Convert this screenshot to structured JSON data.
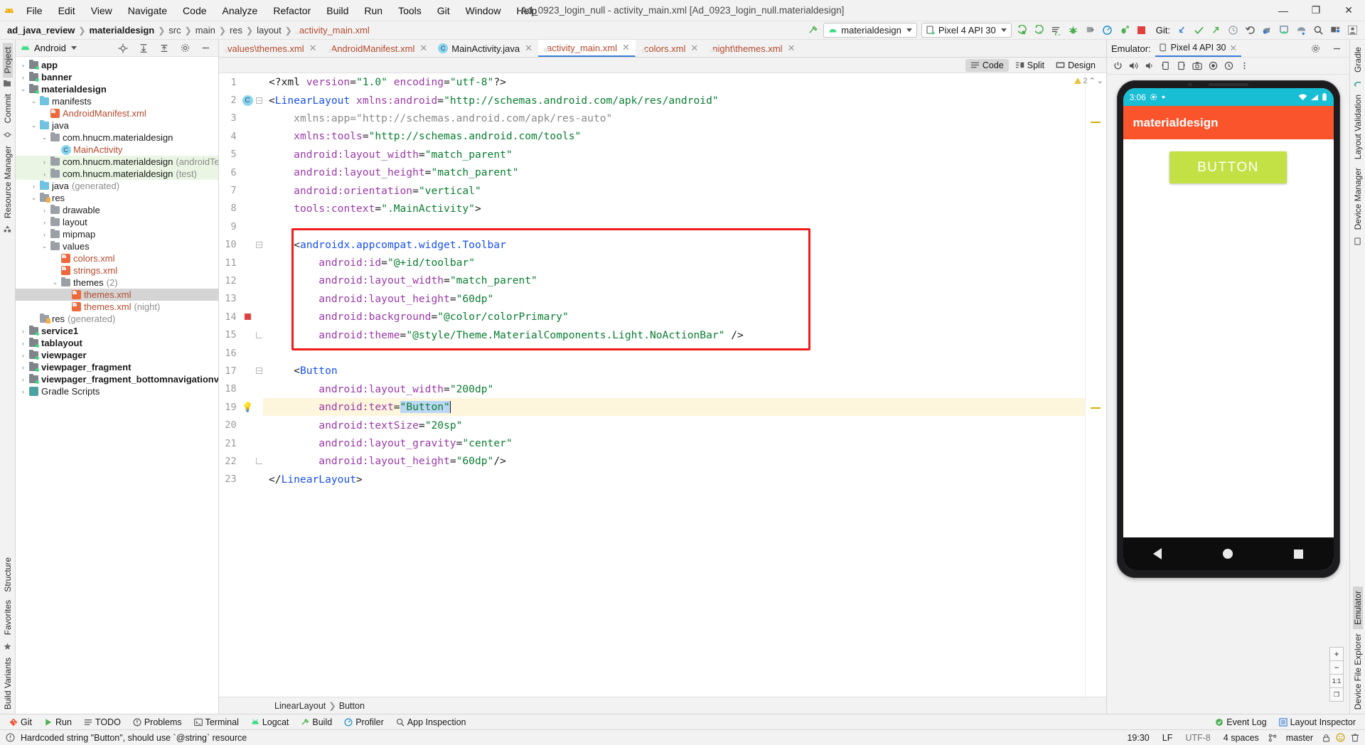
{
  "window": {
    "title": "Ad_0923_login_null - activity_main.xml [Ad_0923_login_null.materialdesign]",
    "minimize": "—",
    "maximize": "❐",
    "close": "✕"
  },
  "menu": [
    "File",
    "Edit",
    "View",
    "Navigate",
    "Code",
    "Analyze",
    "Refactor",
    "Build",
    "Run",
    "Tools",
    "Git",
    "Window",
    "Help"
  ],
  "breadcrumbs": [
    {
      "label": "ad_java_review",
      "bold": true
    },
    {
      "label": "materialdesign",
      "bold": true
    },
    {
      "label": "src",
      "bold": false
    },
    {
      "label": "main",
      "bold": false
    },
    {
      "label": "res",
      "bold": false
    },
    {
      "label": "layout",
      "bold": false
    },
    {
      "label": "activity_main.xml",
      "bold": false,
      "xml": true
    }
  ],
  "toolbar": {
    "run_config": "materialdesign",
    "device": "Pixel 4 API 30",
    "git_label": "Git:"
  },
  "project": {
    "selector": "Android",
    "tree": [
      {
        "indent": 0,
        "arrow": "›",
        "icon": "module",
        "label": "app",
        "bold": true
      },
      {
        "indent": 0,
        "arrow": "›",
        "icon": "module",
        "label": "banner",
        "bold": true
      },
      {
        "indent": 0,
        "arrow": "⌄",
        "icon": "module",
        "label": "materialdesign",
        "bold": true
      },
      {
        "indent": 1,
        "arrow": "⌄",
        "icon": "folder-blue",
        "label": "manifests"
      },
      {
        "indent": 2,
        "arrow": "",
        "icon": "manifest",
        "label": "AndroidManifest.xml",
        "xml": true
      },
      {
        "indent": 1,
        "arrow": "⌄",
        "icon": "folder-blue",
        "label": "java"
      },
      {
        "indent": 2,
        "arrow": "⌄",
        "icon": "folder",
        "label": "com.hnucm.materialdesign"
      },
      {
        "indent": 3,
        "arrow": "",
        "icon": "class",
        "label": "MainActivity",
        "xml": true
      },
      {
        "indent": 2,
        "arrow": "›",
        "icon": "folder",
        "label": "com.hnucm.materialdesign",
        "sub": "(androidTest)",
        "green": true
      },
      {
        "indent": 2,
        "arrow": "›",
        "icon": "folder",
        "label": "com.hnucm.materialdesign",
        "sub": "(test)",
        "green": true
      },
      {
        "indent": 1,
        "arrow": "›",
        "icon": "folder-gen",
        "label": "java",
        "sub": "(generated)"
      },
      {
        "indent": 1,
        "arrow": "⌄",
        "icon": "res",
        "label": "res"
      },
      {
        "indent": 2,
        "arrow": "›",
        "icon": "folder",
        "label": "drawable"
      },
      {
        "indent": 2,
        "arrow": "›",
        "icon": "folder",
        "label": "layout"
      },
      {
        "indent": 2,
        "arrow": "›",
        "icon": "folder",
        "label": "mipmap"
      },
      {
        "indent": 2,
        "arrow": "⌄",
        "icon": "folder",
        "label": "values"
      },
      {
        "indent": 3,
        "arrow": "",
        "icon": "xml",
        "label": "colors.xml",
        "xml": true
      },
      {
        "indent": 3,
        "arrow": "",
        "icon": "xml",
        "label": "strings.xml",
        "xml": true
      },
      {
        "indent": 3,
        "arrow": "⌄",
        "icon": "folder",
        "label": "themes",
        "sub": "(2)"
      },
      {
        "indent": 4,
        "arrow": "",
        "icon": "xml",
        "label": "themes.xml",
        "xml": true,
        "selected": true
      },
      {
        "indent": 4,
        "arrow": "",
        "icon": "xml",
        "label": "themes.xml",
        "sub": "(night)",
        "xml": true
      },
      {
        "indent": 1,
        "arrow": "",
        "icon": "res",
        "label": "res",
        "sub": "(generated)"
      },
      {
        "indent": 0,
        "arrow": "›",
        "icon": "module",
        "label": "service1",
        "bold": true
      },
      {
        "indent": 0,
        "arrow": "›",
        "icon": "module",
        "label": "tablayout",
        "bold": true
      },
      {
        "indent": 0,
        "arrow": "›",
        "icon": "module",
        "label": "viewpager",
        "bold": true
      },
      {
        "indent": 0,
        "arrow": "›",
        "icon": "module",
        "label": "viewpager_fragment",
        "bold": true
      },
      {
        "indent": 0,
        "arrow": "›",
        "icon": "module",
        "label": "viewpager_fragment_bottomnavigationview",
        "bold": true
      },
      {
        "indent": 0,
        "arrow": "›",
        "icon": "gradle",
        "label": "Gradle Scripts",
        "bold": false
      }
    ]
  },
  "left_rail": [
    "Project",
    "Commit",
    "Resource Manager"
  ],
  "right_rail": [
    "Gradle",
    "Layout Validation",
    "Device Manager",
    "Emulator",
    "Device File Explorer"
  ],
  "far_left_bottom_rail": [
    "Structure",
    "Favorites",
    "Build Variants"
  ],
  "editor_tabs": [
    {
      "label": "values\\themes.xml",
      "icon": "xml",
      "active": false
    },
    {
      "label": "AndroidManifest.xml",
      "icon": "manifest",
      "active": false
    },
    {
      "label": "MainActivity.java",
      "icon": "class",
      "active": false
    },
    {
      "label": "activity_main.xml",
      "icon": "xml",
      "active": true
    },
    {
      "label": "colors.xml",
      "icon": "xml",
      "active": false
    },
    {
      "label": "night\\themes.xml",
      "icon": "xml",
      "active": false
    }
  ],
  "view_modes": [
    {
      "label": "Code",
      "active": true
    },
    {
      "label": "Split",
      "active": false
    },
    {
      "label": "Design",
      "active": false
    }
  ],
  "inspection": {
    "warning_count": "2"
  },
  "code": {
    "lines": [
      {
        "n": 1,
        "segments": [
          {
            "t": "<?xml ",
            "c": "punct"
          },
          {
            "t": "version",
            "c": "attr"
          },
          {
            "t": "=",
            "c": "punct"
          },
          {
            "t": "\"1.0\"",
            "c": "val"
          },
          {
            "t": " ",
            "c": "punct"
          },
          {
            "t": "encoding",
            "c": "attr"
          },
          {
            "t": "=",
            "c": "punct"
          },
          {
            "t": "\"utf-8\"",
            "c": "val"
          },
          {
            "t": "?>",
            "c": "punct"
          }
        ]
      },
      {
        "n": 2,
        "marker": "class",
        "fold": "open",
        "segments": [
          {
            "t": "<",
            "c": "punct"
          },
          {
            "t": "LinearLayout",
            "c": "tag"
          },
          {
            "t": " ",
            "c": "punct"
          },
          {
            "t": "xmlns:android",
            "c": "ns"
          },
          {
            "t": "=",
            "c": "punct"
          },
          {
            "t": "\"http://schemas.android.com/apk/res/android\"",
            "c": "val"
          }
        ]
      },
      {
        "n": 3,
        "segments": [
          {
            "t": "    ",
            "c": "punct"
          },
          {
            "t": "xmlns:app",
            "c": "gray"
          },
          {
            "t": "=",
            "c": "gray"
          },
          {
            "t": "\"http://schemas.android.com/apk/res-auto\"",
            "c": "gray"
          }
        ]
      },
      {
        "n": 4,
        "segments": [
          {
            "t": "    ",
            "c": "punct"
          },
          {
            "t": "xmlns:tools",
            "c": "ns"
          },
          {
            "t": "=",
            "c": "punct"
          },
          {
            "t": "\"http://schemas.android.com/tools\"",
            "c": "val"
          }
        ]
      },
      {
        "n": 5,
        "segments": [
          {
            "t": "    ",
            "c": "punct"
          },
          {
            "t": "android:layout_width",
            "c": "attr"
          },
          {
            "t": "=",
            "c": "punct"
          },
          {
            "t": "\"match_parent\"",
            "c": "val"
          }
        ]
      },
      {
        "n": 6,
        "segments": [
          {
            "t": "    ",
            "c": "punct"
          },
          {
            "t": "android:layout_height",
            "c": "attr"
          },
          {
            "t": "=",
            "c": "punct"
          },
          {
            "t": "\"match_parent\"",
            "c": "val"
          }
        ]
      },
      {
        "n": 7,
        "segments": [
          {
            "t": "    ",
            "c": "punct"
          },
          {
            "t": "android:orientation",
            "c": "attr"
          },
          {
            "t": "=",
            "c": "punct"
          },
          {
            "t": "\"vertical\"",
            "c": "val"
          }
        ]
      },
      {
        "n": 8,
        "segments": [
          {
            "t": "    ",
            "c": "punct"
          },
          {
            "t": "tools:context",
            "c": "attr"
          },
          {
            "t": "=",
            "c": "punct"
          },
          {
            "t": "\".MainActivity\"",
            "c": "val"
          },
          {
            "t": ">",
            "c": "punct"
          }
        ]
      },
      {
        "n": 9,
        "segments": []
      },
      {
        "n": 10,
        "fold": "closed",
        "segments": [
          {
            "t": "    <",
            "c": "punct"
          },
          {
            "t": "androidx.appcompat.widget.Toolbar",
            "c": "tag"
          }
        ]
      },
      {
        "n": 11,
        "segments": [
          {
            "t": "        ",
            "c": "punct"
          },
          {
            "t": "android:id",
            "c": "attr"
          },
          {
            "t": "=",
            "c": "punct"
          },
          {
            "t": "\"@+id/toolbar\"",
            "c": "val"
          }
        ]
      },
      {
        "n": 12,
        "segments": [
          {
            "t": "        ",
            "c": "punct"
          },
          {
            "t": "android:layout_width",
            "c": "attr"
          },
          {
            "t": "=",
            "c": "punct"
          },
          {
            "t": "\"match_parent\"",
            "c": "val"
          }
        ]
      },
      {
        "n": 13,
        "segments": [
          {
            "t": "        ",
            "c": "punct"
          },
          {
            "t": "android:layout_height",
            "c": "attr"
          },
          {
            "t": "=",
            "c": "punct"
          },
          {
            "t": "\"60dp\"",
            "c": "val"
          }
        ]
      },
      {
        "n": 14,
        "marker": "error",
        "segments": [
          {
            "t": "        ",
            "c": "punct"
          },
          {
            "t": "android:background",
            "c": "attr"
          },
          {
            "t": "=",
            "c": "punct"
          },
          {
            "t": "\"@color/colorPrimary\"",
            "c": "val"
          }
        ]
      },
      {
        "n": 15,
        "fold": "end",
        "segments": [
          {
            "t": "        ",
            "c": "punct"
          },
          {
            "t": "android:theme",
            "c": "attr"
          },
          {
            "t": "=",
            "c": "punct"
          },
          {
            "t": "\"@style/Theme.MaterialComponents.Light.NoActionBar\"",
            "c": "val"
          },
          {
            "t": " />",
            "c": "punct"
          }
        ]
      },
      {
        "n": 16,
        "segments": []
      },
      {
        "n": 17,
        "fold": "closed",
        "segments": [
          {
            "t": "    <",
            "c": "punct"
          },
          {
            "t": "Button",
            "c": "tag"
          }
        ]
      },
      {
        "n": 18,
        "segments": [
          {
            "t": "        ",
            "c": "punct"
          },
          {
            "t": "android:layout_width",
            "c": "attr"
          },
          {
            "t": "=",
            "c": "punct"
          },
          {
            "t": "\"200dp\"",
            "c": "val"
          }
        ]
      },
      {
        "n": 19,
        "marker": "bulb",
        "highlight": true,
        "segments": [
          {
            "t": "        ",
            "c": "punct"
          },
          {
            "t": "android:text",
            "c": "attr"
          },
          {
            "t": "=",
            "c": "punct"
          },
          {
            "t": "\"Button",
            "c": "val-sel"
          },
          {
            "t": "\"",
            "c": "val-sel"
          }
        ],
        "cursor": true
      },
      {
        "n": 20,
        "segments": [
          {
            "t": "        ",
            "c": "punct"
          },
          {
            "t": "android:textSize",
            "c": "attr"
          },
          {
            "t": "=",
            "c": "punct"
          },
          {
            "t": "\"20sp\"",
            "c": "val"
          }
        ]
      },
      {
        "n": 21,
        "segments": [
          {
            "t": "        ",
            "c": "punct"
          },
          {
            "t": "android:layout_gravity",
            "c": "attr"
          },
          {
            "t": "=",
            "c": "punct"
          },
          {
            "t": "\"center\"",
            "c": "val"
          }
        ]
      },
      {
        "n": 22,
        "fold": "end",
        "segments": [
          {
            "t": "        ",
            "c": "punct"
          },
          {
            "t": "android:layout_height",
            "c": "attr"
          },
          {
            "t": "=",
            "c": "punct"
          },
          {
            "t": "\"60dp\"",
            "c": "val"
          },
          {
            "t": "/>",
            "c": "punct"
          }
        ]
      },
      {
        "n": 23,
        "fold": "endmain",
        "segments": [
          {
            "t": "</",
            "c": "punct"
          },
          {
            "t": "LinearLayout",
            "c": "tag"
          },
          {
            "t": ">",
            "c": "punct"
          }
        ]
      }
    ]
  },
  "editor_breadcrumb": [
    "LinearLayout",
    "Button"
  ],
  "emulator": {
    "panel_label": "Emulator:",
    "tab_label": "Pixel 4 API 30",
    "zoom_in": "+",
    "zoom_out": "−",
    "zoom_fit": "1:1",
    "zoom_actual": "❐",
    "device": {
      "status_time": "3:06",
      "app_title": "materialdesign",
      "button_label": "BUTTON",
      "status_bar_color": "#18bed4",
      "toolbar_color": "#f9542b",
      "button_color": "#c3e044"
    }
  },
  "bottom_tools": [
    {
      "label": "Git",
      "icon": "git"
    },
    {
      "label": "Run",
      "icon": "run"
    },
    {
      "label": "TODO",
      "icon": "todo"
    },
    {
      "label": "Problems",
      "icon": "problems"
    },
    {
      "label": "Terminal",
      "icon": "terminal"
    },
    {
      "label": "Logcat",
      "icon": "logcat"
    },
    {
      "label": "Build",
      "icon": "build"
    },
    {
      "label": "Profiler",
      "icon": "profiler"
    },
    {
      "label": "App Inspection",
      "icon": "inspection"
    }
  ],
  "bottom_right_tools": [
    {
      "label": "Event Log",
      "icon": "event-log"
    },
    {
      "label": "Layout Inspector",
      "icon": "layout-inspector"
    }
  ],
  "status_bar": {
    "message": "Hardcoded string \"Button\", should use `@string` resource",
    "caret": "19:30",
    "line_sep": "LF",
    "encoding": "UTF-8",
    "indent": "4 spaces",
    "branch": "master"
  }
}
